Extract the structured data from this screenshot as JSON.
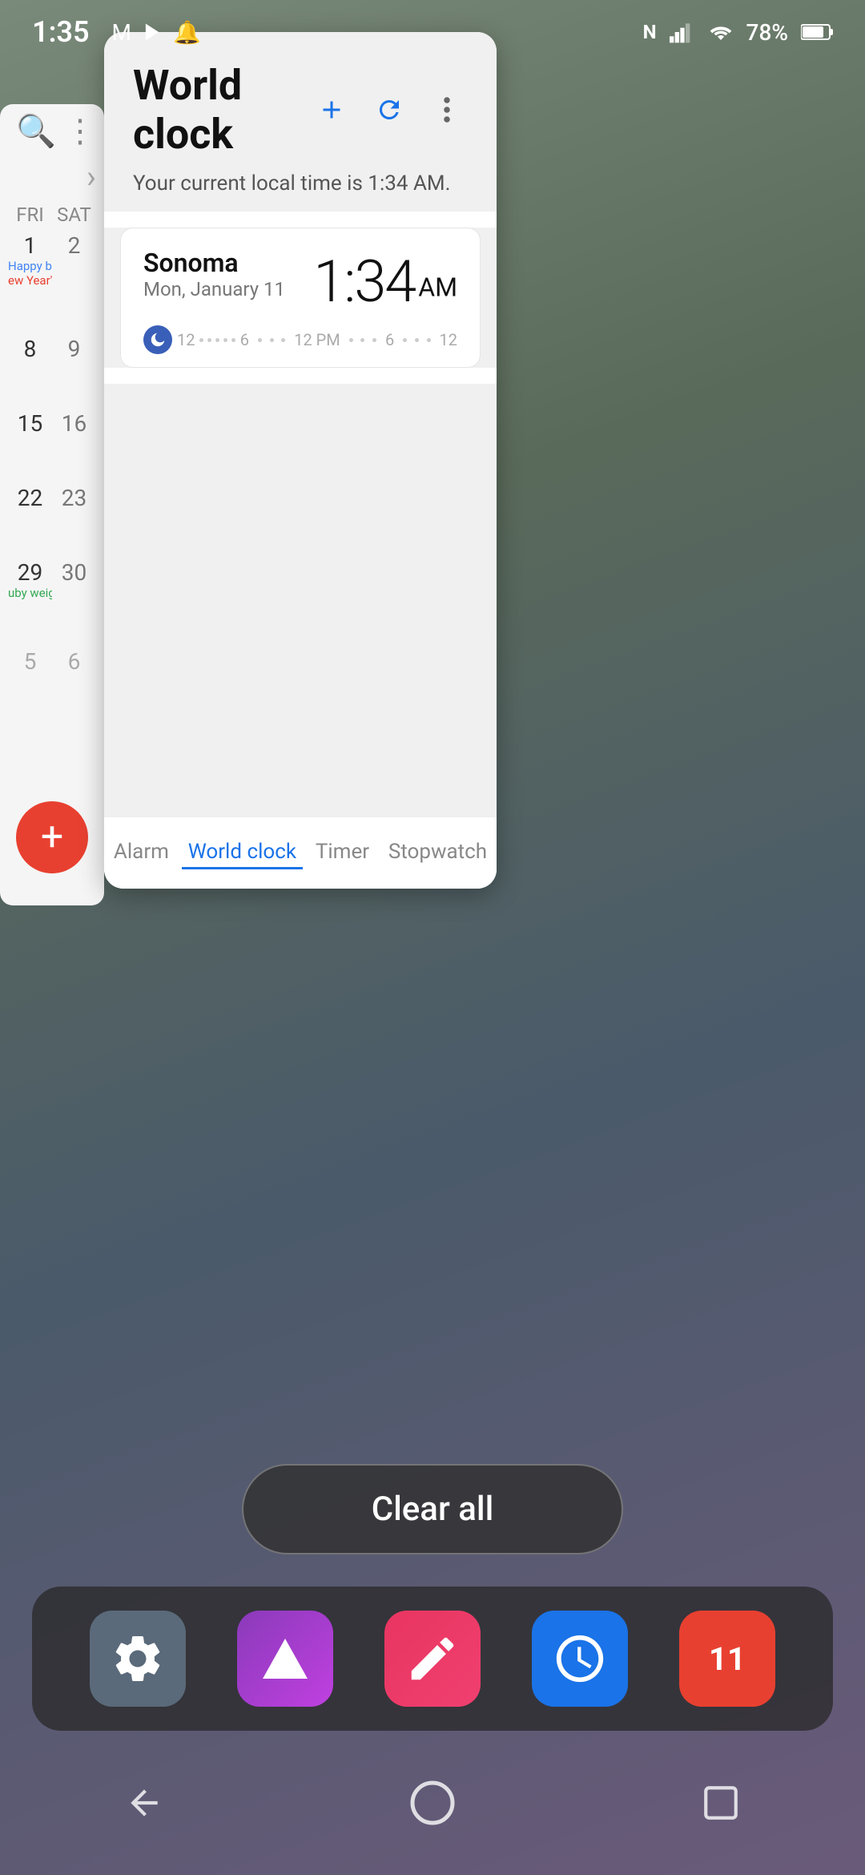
{
  "statusBar": {
    "time": "1:35",
    "battery": "78%",
    "icons": [
      "gmail",
      "notification",
      "bell",
      "N",
      "signal",
      "wifi"
    ]
  },
  "background": {
    "color": "#556655"
  },
  "clockWidget": {
    "title": "World clock",
    "subtitle": "Your current local time is 1:34 AM.",
    "addLabel": "+",
    "refreshLabel": "↺",
    "moreLabel": "⋮",
    "location": {
      "city": "Sonoma",
      "date": "Mon, January 11",
      "time": "1:34",
      "ampm": "AM",
      "timelineLabels": [
        "12",
        "6",
        "12 PM",
        "6",
        "12"
      ]
    },
    "tabs": [
      {
        "label": "Alarm",
        "active": false
      },
      {
        "label": "World clock",
        "active": true
      },
      {
        "label": "Timer",
        "active": false
      },
      {
        "label": "Stopwatch",
        "active": false
      }
    ]
  },
  "calendar": {
    "dayHeaders": [
      "FRI",
      "SAT"
    ],
    "rows": [
      {
        "cells": [
          "1",
          "2"
        ],
        "events": [
          "Happy birthd",
          "ew Year's D"
        ]
      },
      {
        "cells": [
          "8",
          "9"
        ]
      },
      {
        "cells": [
          "15",
          "16"
        ]
      },
      {
        "cells": [
          "22",
          "23"
        ]
      },
      {
        "cells": [
          "29",
          "30"
        ],
        "events": [
          "uby weight c",
          ""
        ]
      },
      {
        "cells": [
          "5",
          "6"
        ]
      }
    ]
  },
  "clearAll": {
    "label": "Clear all"
  },
  "dock": [
    {
      "name": "Settings",
      "type": "settings"
    },
    {
      "name": "CapCut",
      "type": "capcut"
    },
    {
      "name": "Slides",
      "type": "slides"
    },
    {
      "name": "Clock",
      "type": "clock"
    },
    {
      "name": "Calendar",
      "type": "calendar",
      "badge": "11"
    }
  ],
  "navBar": {
    "back": "◁",
    "home": "○",
    "recents": "□"
  }
}
